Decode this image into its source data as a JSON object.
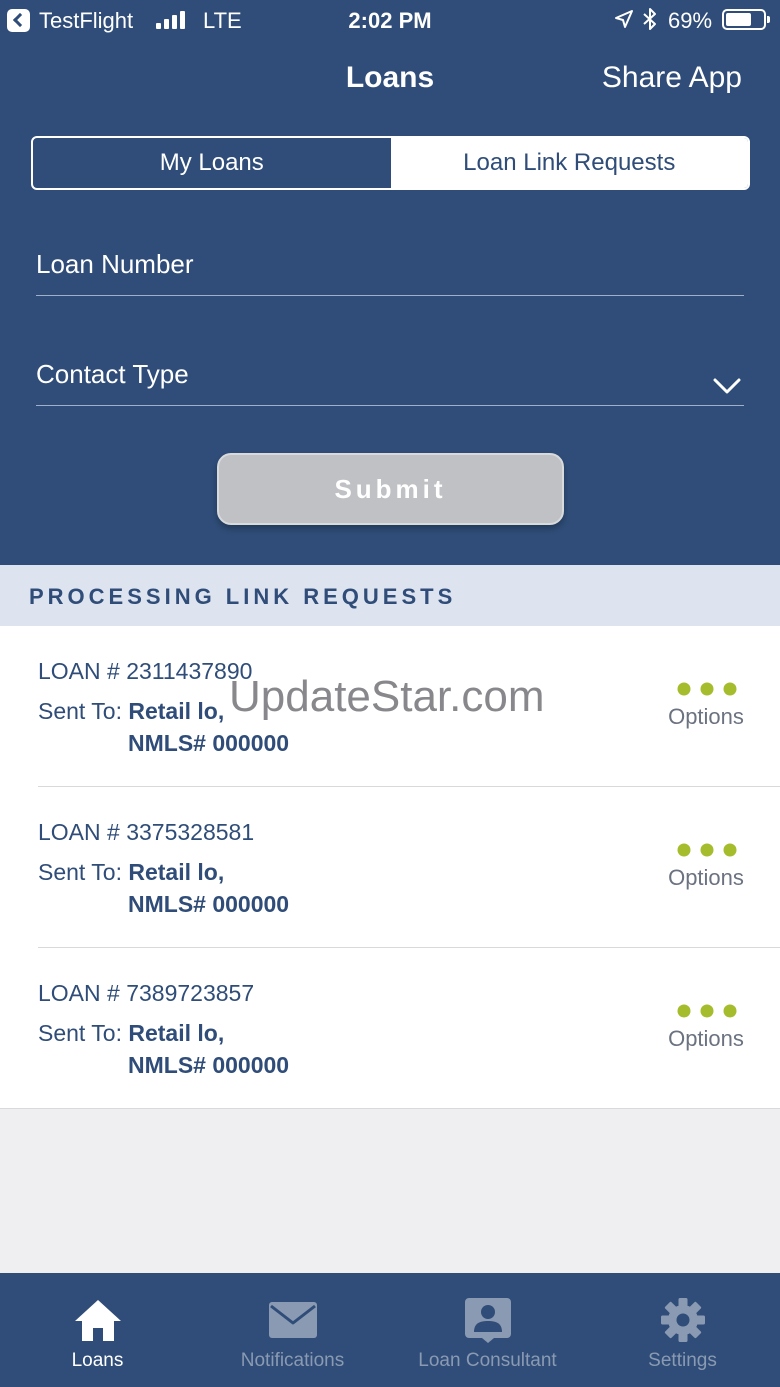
{
  "status_bar": {
    "carrier": "TestFlight",
    "network": "LTE",
    "time": "2:02 PM",
    "battery_percent": "69%",
    "battery_level": 0.69,
    "signal_bars": 4,
    "icons": [
      "back-icon",
      "signal-icon",
      "location-icon",
      "bluetooth-icon",
      "battery-icon"
    ]
  },
  "nav": {
    "title": "Loans",
    "share_label": "Share App"
  },
  "segmented": {
    "tabs": [
      {
        "label": "My Loans",
        "selected": false
      },
      {
        "label": "Loan Link Requests",
        "selected": true
      }
    ]
  },
  "form": {
    "loan_number_placeholder": "Loan Number",
    "loan_number_value": "",
    "contact_type_value": "Contact Type",
    "submit_label": "Submit"
  },
  "section": {
    "title": "PROCESSING LINK REQUESTS"
  },
  "requests": [
    {
      "loan_label": "LOAN # 2311437890",
      "sent_to_label": "Sent To:",
      "recipient": "Retail lo,",
      "nmls": "NMLS# 000000",
      "options_label": "Options"
    },
    {
      "loan_label": "LOAN # 3375328581",
      "sent_to_label": "Sent To:",
      "recipient": "Retail lo,",
      "nmls": "NMLS# 000000",
      "options_label": "Options"
    },
    {
      "loan_label": "LOAN # 7389723857",
      "sent_to_label": "Sent To:",
      "recipient": "Retail lo,",
      "nmls": "NMLS# 000000",
      "options_label": "Options"
    }
  ],
  "watermark": "UpdateStar.com",
  "tab_bar": {
    "tabs": [
      {
        "label": "Loans",
        "icon": "home-icon",
        "active": true
      },
      {
        "label": "Notifications",
        "icon": "envelope-icon",
        "active": false
      },
      {
        "label": "Loan Consultant",
        "icon": "person-badge-icon",
        "active": false
      },
      {
        "label": "Settings",
        "icon": "gear-icon",
        "active": false
      }
    ]
  },
  "colors": {
    "header_bg": "#2f4d78",
    "accent_green": "#a5bd2c",
    "section_bg": "#dde4f0",
    "text_blue": "#2f4d78",
    "tab_inactive": "#8a9ab2"
  }
}
